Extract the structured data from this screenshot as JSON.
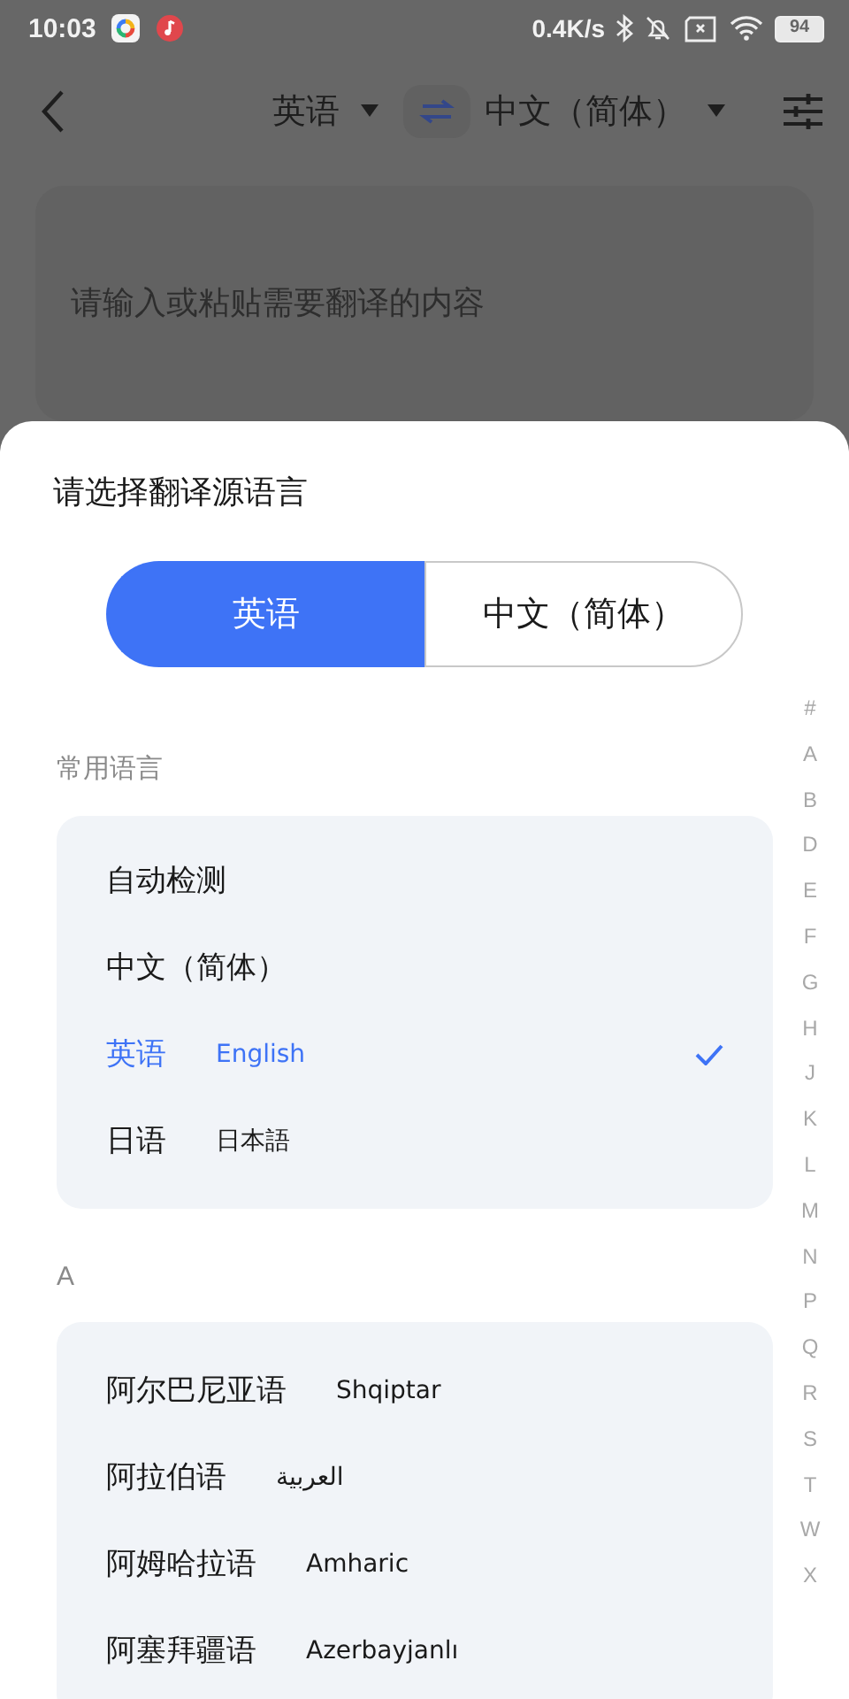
{
  "status_bar": {
    "time": "10:03",
    "net_speed": "0.4K/s",
    "battery": "94"
  },
  "toolbar": {
    "source_language": "英语",
    "target_language": "中文（简体）"
  },
  "input": {
    "placeholder": "请输入或粘贴需要翻译的内容"
  },
  "sheet": {
    "title": "请选择翻译源语言",
    "segments": [
      {
        "label": "英语",
        "selected": true
      },
      {
        "label": "中文（简体）",
        "selected": false
      }
    ],
    "sections": [
      {
        "header": "常用语言",
        "items": [
          {
            "name": "自动检测",
            "selected": false
          },
          {
            "name": "中文（简体）",
            "selected": false
          },
          {
            "name": "英语",
            "native": "English",
            "selected": true
          },
          {
            "name": "日语",
            "native": "日本語",
            "selected": false
          }
        ]
      },
      {
        "header": "A",
        "items": [
          {
            "name": "阿尔巴尼亚语",
            "native": "Shqiptar",
            "selected": false
          },
          {
            "name": "阿拉伯语",
            "native": "العربية",
            "selected": false
          },
          {
            "name": "阿姆哈拉语",
            "native": "Amharic",
            "selected": false
          },
          {
            "name": "阿塞拜疆语",
            "native": "Azerbayjanlı",
            "selected": false
          }
        ]
      }
    ],
    "index": [
      "#",
      "A",
      "B",
      "D",
      "E",
      "F",
      "G",
      "H",
      "J",
      "K",
      "L",
      "M",
      "N",
      "P",
      "Q",
      "R",
      "S",
      "T",
      "W",
      "X"
    ]
  }
}
